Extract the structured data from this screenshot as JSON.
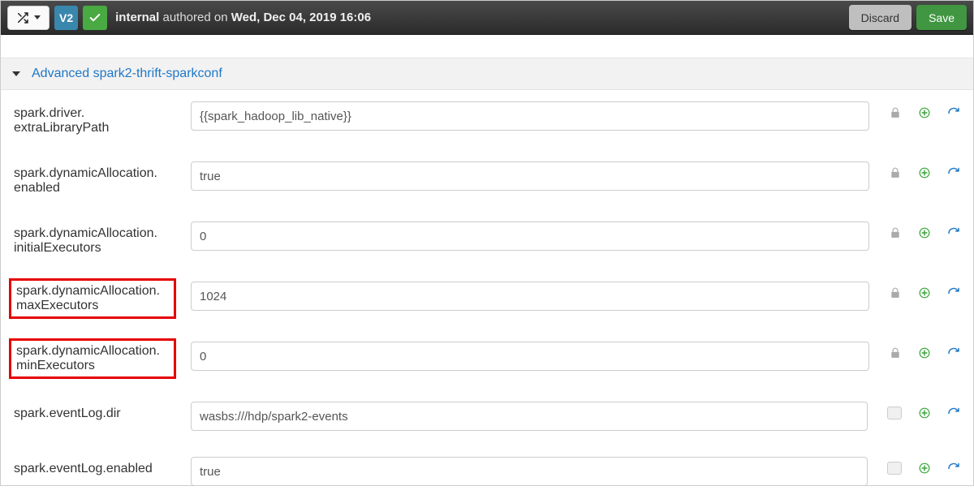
{
  "toolbar": {
    "version_label": "V2",
    "author": "internal",
    "authored_on_text": "authored on",
    "date": "Wed, Dec 04, 2019 16:06",
    "discard_label": "Discard",
    "save_label": "Save"
  },
  "section": {
    "title": "Advanced spark2-thrift-sparkconf"
  },
  "properties": [
    {
      "key_leading": "spark.driver.",
      "key_trailing": "extraLibraryPath",
      "value": "{{spark_hadoop_lib_native}}",
      "highlight": false,
      "lock_active": false
    },
    {
      "key_leading": "spark.dynamicAllocation.",
      "key_trailing": "enabled",
      "value": "true",
      "highlight": false,
      "lock_active": false
    },
    {
      "key_leading": "spark.dynamicAllocation.",
      "key_trailing": "initialExecutors",
      "value": "0",
      "highlight": false,
      "lock_active": false
    },
    {
      "key_leading": "spark.dynamicAllocation.",
      "key_trailing": "maxExecutors",
      "value": "1024",
      "highlight": true,
      "lock_active": false
    },
    {
      "key_leading": "spark.dynamicAllocation.",
      "key_trailing": "minExecutors",
      "value": "0",
      "highlight": true,
      "lock_active": false
    },
    {
      "key_leading": "spark.eventLog.dir",
      "key_trailing": "",
      "value": "wasbs:///hdp/spark2-events",
      "highlight": false,
      "lock_active": true
    },
    {
      "key_leading": "spark.eventLog.enabled",
      "key_trailing": "",
      "value": "true",
      "highlight": false,
      "lock_active": true
    }
  ]
}
